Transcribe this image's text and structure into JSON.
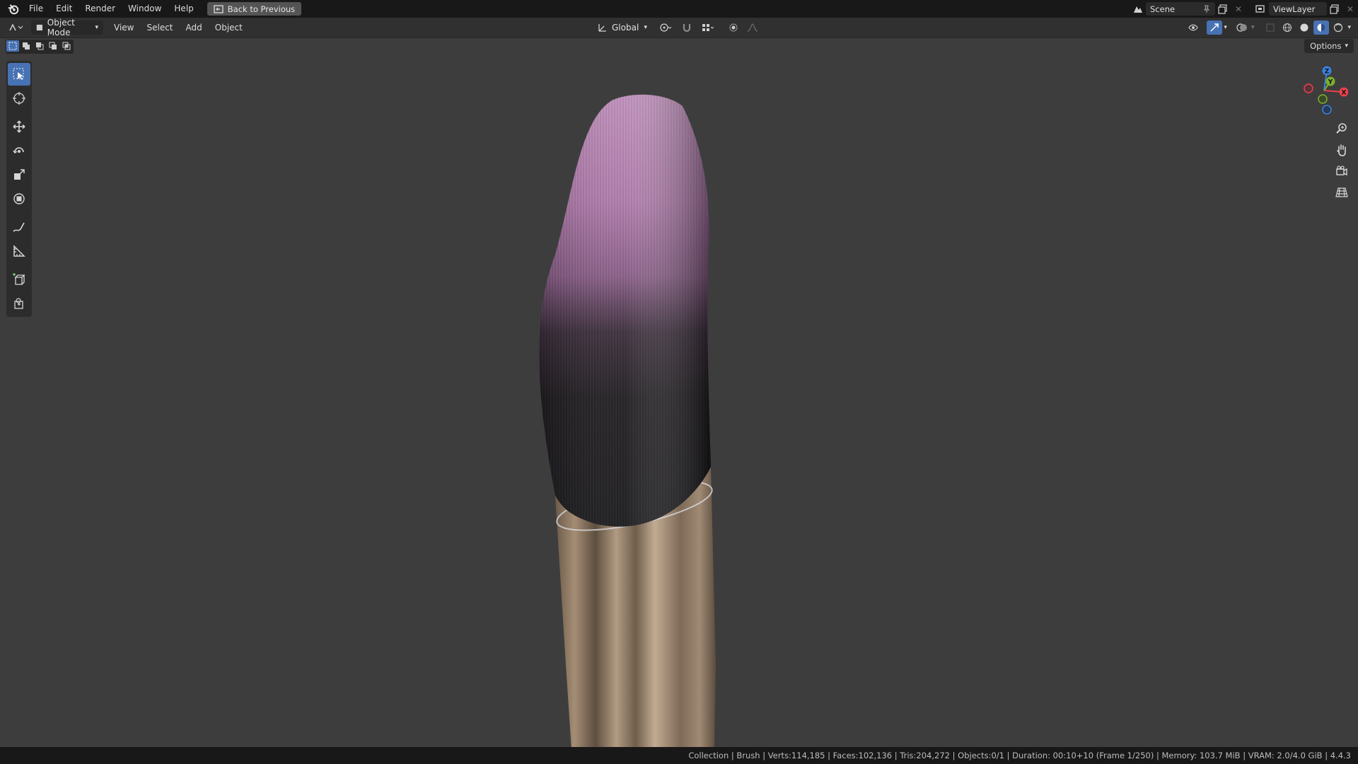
{
  "topbar": {
    "menus": [
      "File",
      "Edit",
      "Render",
      "Window",
      "Help"
    ],
    "back_button": "Back to Previous",
    "scene_name": "Scene",
    "view_layer": "ViewLayer"
  },
  "header": {
    "mode": "Object Mode",
    "menus": [
      "View",
      "Select",
      "Add",
      "Object"
    ],
    "transform_orientation": "Global",
    "options_label": "Options"
  },
  "gizmo": {
    "axes": [
      "Z",
      "Y",
      "X"
    ],
    "colors": {
      "x": "#e8424d",
      "y": "#7bb02a",
      "z": "#3a82e0"
    }
  },
  "statusbar": {
    "text": "Collection | Brush | Verts:114,185 | Faces:102,136 | Tris:204,272 | Objects:0/1 | Duration: 00:10+10 (Frame 1/250) | Memory: 103.7 MiB | VRAM: 2.0/4.0 GiB | 4.4.3"
  },
  "colors": {
    "accent": "#4772b3",
    "bristle_tip": "#b987b6",
    "bristle_base": "#1d1b1e",
    "ferrule": "#8a7561"
  }
}
